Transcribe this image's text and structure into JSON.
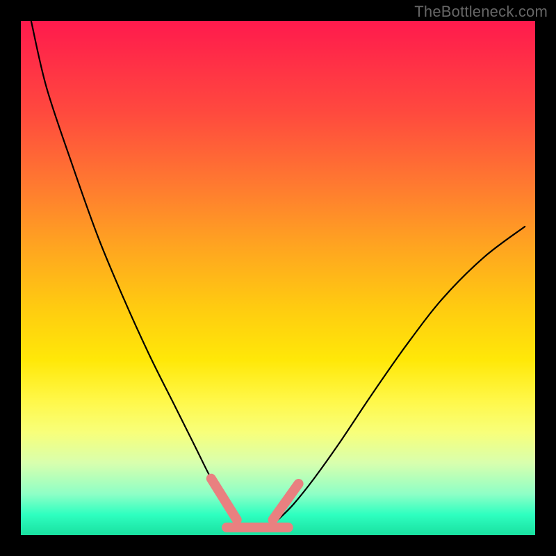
{
  "watermark": "TheBottleneck.com",
  "chart_data": {
    "type": "line",
    "title": "",
    "xlabel": "",
    "ylabel": "",
    "xlim": [
      0,
      100
    ],
    "ylim": [
      0,
      100
    ],
    "grid": false,
    "legend": false,
    "note": "Two monotone curves meeting near the bottom (V-shape) over a vertical red→yellow→green gradient. No axis ticks or numeric labels are visible; x/y are normalized 0–100 of the plot area (y=0 at bottom).",
    "series": [
      {
        "name": "left-curve",
        "color": "#000000",
        "x": [
          2,
          5,
          10,
          15,
          20,
          25,
          30,
          34,
          37,
          40,
          42
        ],
        "values": [
          100,
          87,
          72,
          58,
          46,
          35,
          25,
          17,
          11,
          6,
          3
        ]
      },
      {
        "name": "right-curve",
        "color": "#000000",
        "x": [
          50,
          53,
          57,
          62,
          68,
          75,
          82,
          90,
          98
        ],
        "values": [
          3,
          6,
          11,
          18,
          27,
          37,
          46,
          54,
          60
        ]
      },
      {
        "name": "marker-left",
        "color": "#e98080",
        "style": "thick",
        "x": [
          37,
          42
        ],
        "values": [
          11,
          3
        ]
      },
      {
        "name": "marker-bottom",
        "color": "#e98080",
        "style": "thick",
        "x": [
          40,
          52
        ],
        "values": [
          1.5,
          1.5
        ]
      },
      {
        "name": "marker-right",
        "color": "#e98080",
        "style": "thick",
        "x": [
          49,
          54
        ],
        "values": [
          3,
          10
        ]
      }
    ]
  }
}
